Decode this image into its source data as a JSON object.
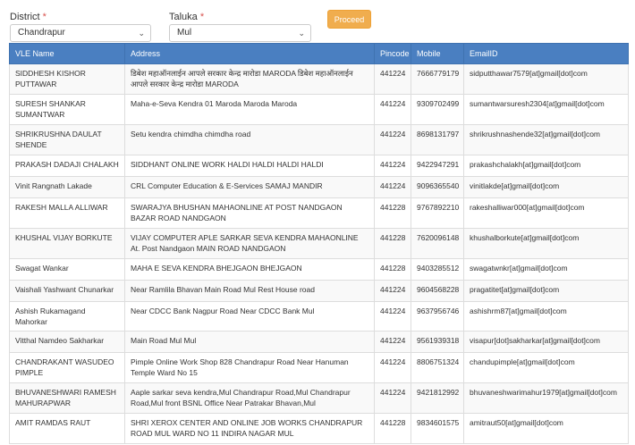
{
  "form": {
    "district_label": "District",
    "district_required": "*",
    "district_value": "Chandrapur",
    "taluka_label": "Taluka",
    "taluka_required": "*",
    "taluka_value": "Mul",
    "chevron_icon": "chevron-down-icon",
    "proceed_label": "Proceed"
  },
  "colors": {
    "header_bg": "#4a7fc1",
    "button_bg": "#f0ad4e",
    "required": "#d9534f"
  },
  "table": {
    "headers": [
      "VLE Name",
      "Address",
      "Pincode",
      "Mobile",
      "EmailID"
    ],
    "rows": [
      [
        "SIDDHESH KISHOR PUTTAWAR",
        "डिबेश महाऑनलाईन आपले सरकार केन्द्र मारोडा MARODA डिबेश महाऑनलाईन आपले सरकार केन्द्र मारोडा MARODA",
        "441224",
        "7666779179",
        "sidputthawar7579[at]gmail[dot]com"
      ],
      [
        "SURESH SHANKAR SUMANTWAR",
        "Maha-e-Seva Kendra 01 Maroda Maroda Maroda",
        "441224",
        "9309702499",
        "sumantwarsuresh2304[at]gmail[dot]com"
      ],
      [
        "SHRIKRUSHNA DAULAT SHENDE",
        "Setu kendra chimdha chimdha road",
        "441224",
        "8698131797",
        "shrikrushnashende32[at]gmail[dot]com"
      ],
      [
        "PRAKASH DADAJI CHALAKH",
        "SIDDHANT ONLINE WORK HALDI HALDI HALDI HALDI",
        "441224",
        "9422947291",
        "prakashchalakh[at]gmail[dot]com"
      ],
      [
        "Vinit Rangnath Lakade",
        "CRL Computer Education & E-Services SAMAJ MANDIR",
        "441224",
        "9096365540",
        "vinitlakde[at]gmail[dot]com"
      ],
      [
        "RAKESH MALLA ALLIWAR",
        "SWARAJYA BHUSHAN MAHAONLINE AT POST NANDGAON BAZAR ROAD NANDGAON",
        "441228",
        "9767892210",
        "rakeshalliwar000[at]gmail[dot]com"
      ],
      [
        "KHUSHAL VIJAY BORKUTE",
        "VIJAY COMPUTER APLE SARKAR SEVA KENDRA MAHAONLINE At. Post Nandgaon MAIN ROAD NANDGAON",
        "441228",
        "7620096148",
        "khushalborkute[at]gmail[dot]com"
      ],
      [
        "Swagat Wankar",
        "MAHA E SEVA KENDRA BHEJGAON BHEJGAON",
        "441228",
        "9403285512",
        "swagatwnkr[at]gmail[dot]com"
      ],
      [
        "Vaishali Yashwant Chunarkar",
        "Near Ramlila Bhavan Main Road Mul Rest House road",
        "441224",
        "9604568228",
        "pragatitet[at]gmail[dot]com"
      ],
      [
        "Ashish Rukamagand Mahorkar",
        "Near CDCC Bank Nagpur Road Near CDCC Bank Mul",
        "441224",
        "9637956746",
        "ashishrm87[at]gmail[dot]com"
      ],
      [
        "Vitthal Namdeo Sakharkar",
        "Main Road Mul Mul",
        "441224",
        "9561939318",
        "visapur[dot]sakharkar[at]gmail[dot]com"
      ],
      [
        "CHANDRAKANT WASUDEO PIMPLE",
        "Pimple Online Work Shop 828 Chandrapur Road Near Hanuman Temple Ward No 15",
        "441224",
        "8806751324",
        "chandupimple[at]gmail[dot]com"
      ],
      [
        "BHUVANESHWARI RAMESH MAHURAPWAR",
        "Aaple sarkar seva kendra,Mul Chandrapur Road,Mul Chandrapur Road,Mul front BSNL Office Near Patrakar Bhavan,Mul",
        "441224",
        "9421812992",
        "bhuvaneshwarimahur1979[at]gmail[dot]com"
      ],
      [
        "AMIT RAMDAS RAUT",
        "SHRI XEROX CENTER AND ONLINE JOB WORKS CHANDRAPUR ROAD MUL WARD NO 11 INDIRA NAGAR MUL",
        "441228",
        "9834601575",
        "amitraut50[at]gmail[dot]com"
      ]
    ]
  }
}
